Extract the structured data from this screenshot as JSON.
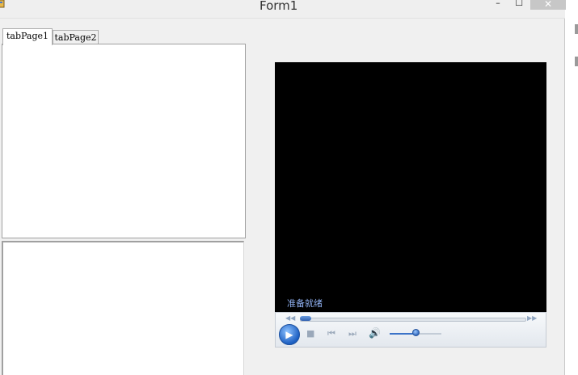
{
  "window": {
    "title": "Form1",
    "minimize_glyph": "–",
    "maximize_glyph": "☐",
    "close_glyph": "✕"
  },
  "tabs": [
    {
      "label": "tabPage1",
      "selected": true
    },
    {
      "label": "tabPage2",
      "selected": false
    }
  ],
  "media_player": {
    "status_text": "准备就绪",
    "seek_progress": 0.0,
    "volume_level": 0.5,
    "controls": {
      "play_glyph": "▶",
      "stop_glyph": "■",
      "prev_glyph": "⏮",
      "next_glyph": "⏭",
      "volume_glyph": "🔊",
      "seek_back_glyph": "◀◀",
      "seek_fwd_glyph": "▶▶"
    }
  },
  "colors": {
    "video_background": "#000000",
    "status_text": "#8fb0f0",
    "accent_blue": "#2d63b8"
  }
}
